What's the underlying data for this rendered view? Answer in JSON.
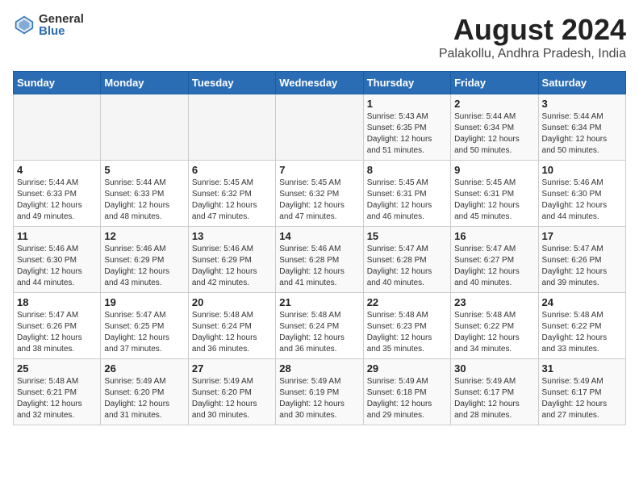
{
  "header": {
    "logo_general": "General",
    "logo_blue": "Blue",
    "title": "August 2024",
    "subtitle": "Palakollu, Andhra Pradesh, India"
  },
  "weekdays": [
    "Sunday",
    "Monday",
    "Tuesday",
    "Wednesday",
    "Thursday",
    "Friday",
    "Saturday"
  ],
  "weeks": [
    [
      {
        "day": "",
        "info": ""
      },
      {
        "day": "",
        "info": ""
      },
      {
        "day": "",
        "info": ""
      },
      {
        "day": "",
        "info": ""
      },
      {
        "day": "1",
        "info": "Sunrise: 5:43 AM\nSunset: 6:35 PM\nDaylight: 12 hours\nand 51 minutes."
      },
      {
        "day": "2",
        "info": "Sunrise: 5:44 AM\nSunset: 6:34 PM\nDaylight: 12 hours\nand 50 minutes."
      },
      {
        "day": "3",
        "info": "Sunrise: 5:44 AM\nSunset: 6:34 PM\nDaylight: 12 hours\nand 50 minutes."
      }
    ],
    [
      {
        "day": "4",
        "info": "Sunrise: 5:44 AM\nSunset: 6:33 PM\nDaylight: 12 hours\nand 49 minutes."
      },
      {
        "day": "5",
        "info": "Sunrise: 5:44 AM\nSunset: 6:33 PM\nDaylight: 12 hours\nand 48 minutes."
      },
      {
        "day": "6",
        "info": "Sunrise: 5:45 AM\nSunset: 6:32 PM\nDaylight: 12 hours\nand 47 minutes."
      },
      {
        "day": "7",
        "info": "Sunrise: 5:45 AM\nSunset: 6:32 PM\nDaylight: 12 hours\nand 47 minutes."
      },
      {
        "day": "8",
        "info": "Sunrise: 5:45 AM\nSunset: 6:31 PM\nDaylight: 12 hours\nand 46 minutes."
      },
      {
        "day": "9",
        "info": "Sunrise: 5:45 AM\nSunset: 6:31 PM\nDaylight: 12 hours\nand 45 minutes."
      },
      {
        "day": "10",
        "info": "Sunrise: 5:46 AM\nSunset: 6:30 PM\nDaylight: 12 hours\nand 44 minutes."
      }
    ],
    [
      {
        "day": "11",
        "info": "Sunrise: 5:46 AM\nSunset: 6:30 PM\nDaylight: 12 hours\nand 44 minutes."
      },
      {
        "day": "12",
        "info": "Sunrise: 5:46 AM\nSunset: 6:29 PM\nDaylight: 12 hours\nand 43 minutes."
      },
      {
        "day": "13",
        "info": "Sunrise: 5:46 AM\nSunset: 6:29 PM\nDaylight: 12 hours\nand 42 minutes."
      },
      {
        "day": "14",
        "info": "Sunrise: 5:46 AM\nSunset: 6:28 PM\nDaylight: 12 hours\nand 41 minutes."
      },
      {
        "day": "15",
        "info": "Sunrise: 5:47 AM\nSunset: 6:28 PM\nDaylight: 12 hours\nand 40 minutes."
      },
      {
        "day": "16",
        "info": "Sunrise: 5:47 AM\nSunset: 6:27 PM\nDaylight: 12 hours\nand 40 minutes."
      },
      {
        "day": "17",
        "info": "Sunrise: 5:47 AM\nSunset: 6:26 PM\nDaylight: 12 hours\nand 39 minutes."
      }
    ],
    [
      {
        "day": "18",
        "info": "Sunrise: 5:47 AM\nSunset: 6:26 PM\nDaylight: 12 hours\nand 38 minutes."
      },
      {
        "day": "19",
        "info": "Sunrise: 5:47 AM\nSunset: 6:25 PM\nDaylight: 12 hours\nand 37 minutes."
      },
      {
        "day": "20",
        "info": "Sunrise: 5:48 AM\nSunset: 6:24 PM\nDaylight: 12 hours\nand 36 minutes."
      },
      {
        "day": "21",
        "info": "Sunrise: 5:48 AM\nSunset: 6:24 PM\nDaylight: 12 hours\nand 36 minutes."
      },
      {
        "day": "22",
        "info": "Sunrise: 5:48 AM\nSunset: 6:23 PM\nDaylight: 12 hours\nand 35 minutes."
      },
      {
        "day": "23",
        "info": "Sunrise: 5:48 AM\nSunset: 6:22 PM\nDaylight: 12 hours\nand 34 minutes."
      },
      {
        "day": "24",
        "info": "Sunrise: 5:48 AM\nSunset: 6:22 PM\nDaylight: 12 hours\nand 33 minutes."
      }
    ],
    [
      {
        "day": "25",
        "info": "Sunrise: 5:48 AM\nSunset: 6:21 PM\nDaylight: 12 hours\nand 32 minutes."
      },
      {
        "day": "26",
        "info": "Sunrise: 5:49 AM\nSunset: 6:20 PM\nDaylight: 12 hours\nand 31 minutes."
      },
      {
        "day": "27",
        "info": "Sunrise: 5:49 AM\nSunset: 6:20 PM\nDaylight: 12 hours\nand 30 minutes."
      },
      {
        "day": "28",
        "info": "Sunrise: 5:49 AM\nSunset: 6:19 PM\nDaylight: 12 hours\nand 30 minutes."
      },
      {
        "day": "29",
        "info": "Sunrise: 5:49 AM\nSunset: 6:18 PM\nDaylight: 12 hours\nand 29 minutes."
      },
      {
        "day": "30",
        "info": "Sunrise: 5:49 AM\nSunset: 6:17 PM\nDaylight: 12 hours\nand 28 minutes."
      },
      {
        "day": "31",
        "info": "Sunrise: 5:49 AM\nSunset: 6:17 PM\nDaylight: 12 hours\nand 27 minutes."
      }
    ]
  ]
}
